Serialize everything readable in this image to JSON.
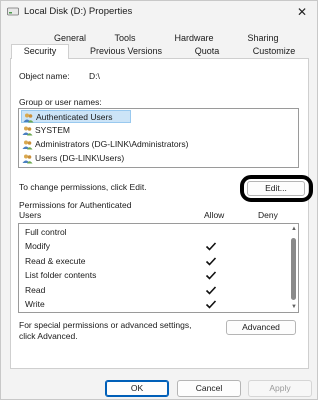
{
  "window": {
    "title": "Local Disk (D:) Properties",
    "close_glyph": "✕"
  },
  "tabs": {
    "row1": [
      "General",
      "Tools",
      "Hardware",
      "Sharing"
    ],
    "row2": [
      "Security",
      "Previous Versions",
      "Quota",
      "Customize"
    ],
    "active": "Security"
  },
  "security": {
    "object_name_label": "Object name:",
    "object_name_value": "D:\\",
    "group_label": "Group or user names:",
    "users": [
      "Authenticated Users",
      "SYSTEM",
      "Administrators (DG-LINK\\Administrators)",
      "Users (DG-LINK\\Users)"
    ],
    "change_text": "To change permissions, click Edit.",
    "edit_label": "Edit...",
    "perm_label_line1": "Permissions for Authenticated",
    "perm_label_line2": "Users",
    "allow_header": "Allow",
    "deny_header": "Deny",
    "permissions": [
      {
        "name": "Full control",
        "allow": false,
        "deny": false
      },
      {
        "name": "Modify",
        "allow": true,
        "deny": false
      },
      {
        "name": "Read & execute",
        "allow": true,
        "deny": false
      },
      {
        "name": "List folder contents",
        "allow": true,
        "deny": false
      },
      {
        "name": "Read",
        "allow": true,
        "deny": false
      },
      {
        "name": "Write",
        "allow": true,
        "deny": false
      }
    ],
    "special_line1": "For special permissions or advanced settings,",
    "special_line2": "click Advanced.",
    "advanced_label": "Advanced"
  },
  "footer": {
    "ok_label": "OK",
    "cancel_label": "Cancel",
    "apply_label": "Apply"
  },
  "colors": {
    "selected_row": "#cce4f7",
    "primary_border": "#005fb8",
    "annotation": "#000000"
  }
}
